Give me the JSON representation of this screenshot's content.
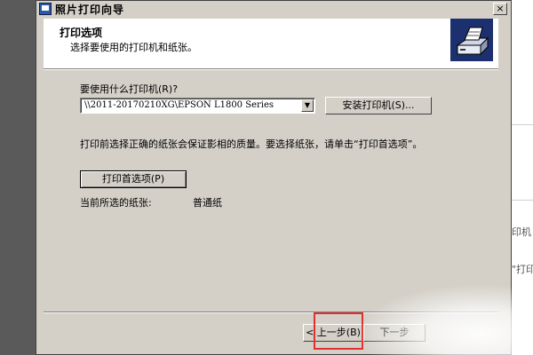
{
  "window": {
    "title": "照片打印向导",
    "close_glyph": "×"
  },
  "header": {
    "title": "打印选项",
    "subtitle": "选择要使用的打印机和纸张。",
    "icon": "printer-icon"
  },
  "printer": {
    "label": "要使用什么打印机(R)?",
    "selected": "\\\\2011-20170210XG\\EPSON L1800 Series",
    "install_button": "安装打印机(S)..."
  },
  "instructions": "打印前选择正确的纸张会保证影相的质量。要选择纸张，请单击“打印首选项”。",
  "preferences_button": "打印首选项(P)",
  "paper": {
    "label": "当前所选的纸张:",
    "value": "普通纸"
  },
  "footer": {
    "back_button": "< 上一步(B)",
    "next_button": "下一步"
  },
  "background_app": {
    "texts": [
      "印机",
      "\"打印"
    ]
  },
  "colors": {
    "dialog_bg": "#d4d0c8",
    "highlight": "#e03030"
  }
}
